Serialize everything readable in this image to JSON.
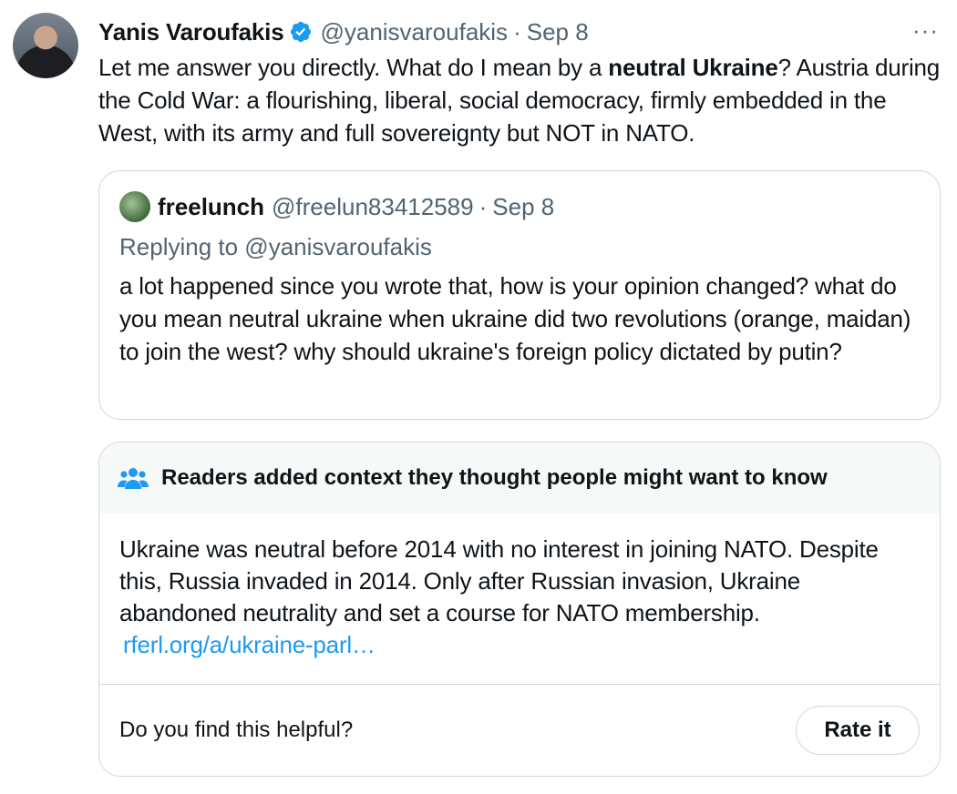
{
  "tweet": {
    "author_name": "Yanis Varoufakis",
    "handle": "@yanisvaroufakis",
    "separator": "·",
    "date": "Sep 8",
    "more_menu": "···",
    "text_part1": "Let me answer you directly. What do I mean by a ",
    "text_bold": "neutral Ukraine",
    "text_part2": "? Austria during the Cold War: a flourishing, liberal,  social democracy, firmly embedded in the West, with its army and full sovereignty but NOT in NATO."
  },
  "quoted_tweet": {
    "author_name": "freelunch",
    "handle": "@freelun83412589",
    "separator": "·",
    "date": "Sep 8",
    "replying_to": "Replying to @yanisvaroufakis",
    "text": "a lot happened since you wrote that, how is your opinion changed? what do you mean neutral ukraine when ukraine did two revolutions (orange, maidan) to join the west? why should ukraine's foreign policy dictated by putin?"
  },
  "community_note": {
    "title": "Readers added context they thought people might want to know",
    "body": "Ukraine was neutral before 2014 with no interest in joining NATO. Despite this, Russia invaded in 2014. Only after Russian invasion, Ukraine abandoned neutrality and set a course for NATO membership.",
    "link": "rferl.org/a/ukraine-parl…",
    "helpful_prompt": "Do you find this helpful?",
    "rate_button": "Rate it"
  },
  "colors": {
    "accent": "#1d9bf0",
    "muted": "#536471",
    "border": "#cfd9de"
  }
}
